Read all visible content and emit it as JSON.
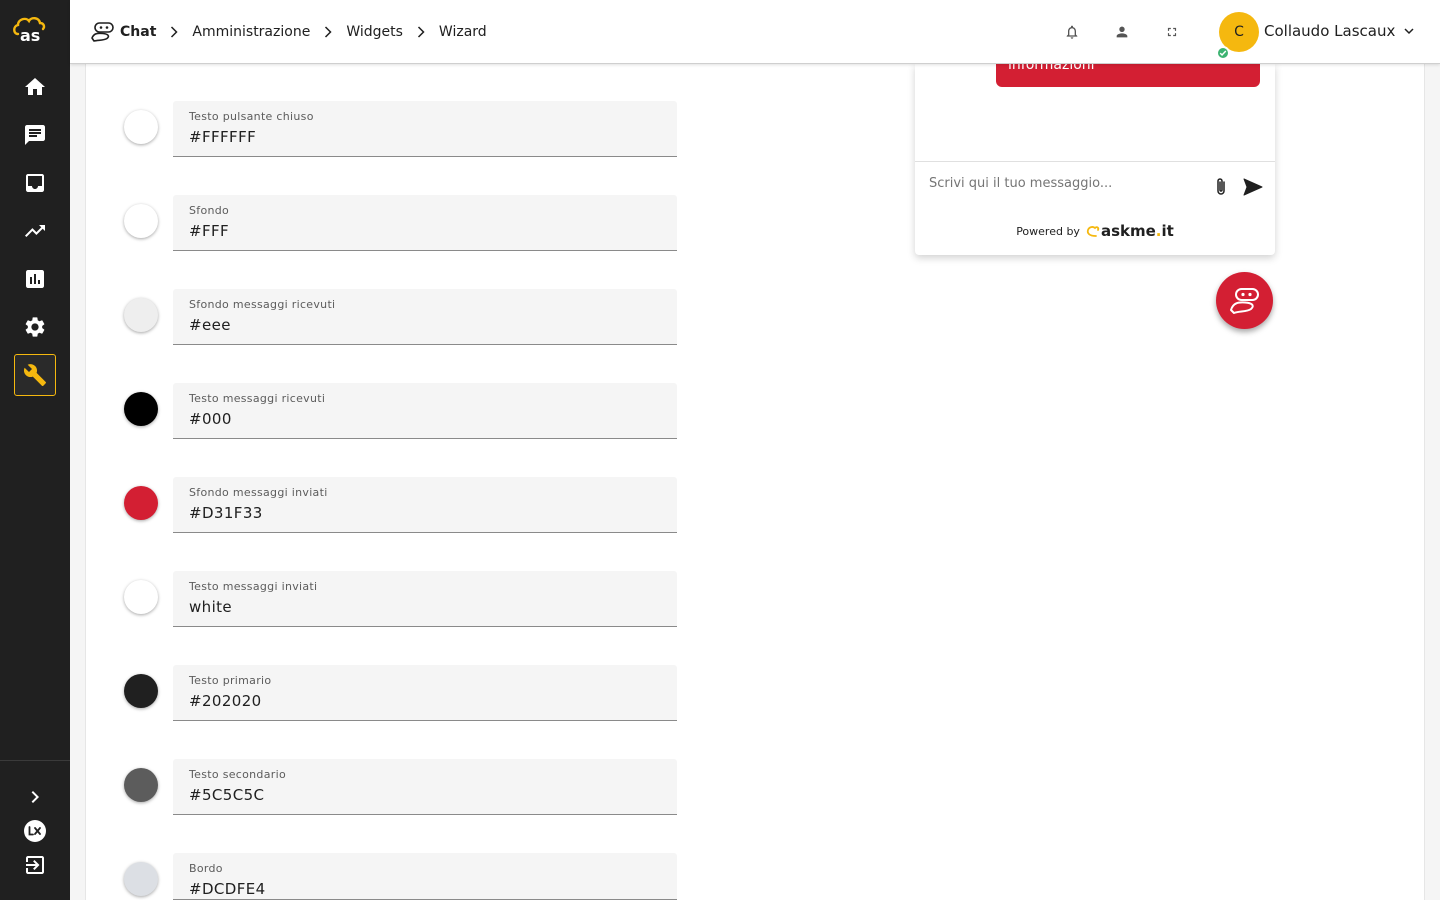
{
  "header": {
    "breadcrumb": [
      "Chat",
      "Amministrazione",
      "Widgets",
      "Wizard"
    ],
    "user": {
      "initial": "C",
      "name": "Collaudo Lascaux"
    }
  },
  "sidebar": {
    "logo_text": "as",
    "items": [
      {
        "icon": "home-icon"
      },
      {
        "icon": "chat-icon"
      },
      {
        "icon": "inbox-icon"
      },
      {
        "icon": "trending-up-icon"
      },
      {
        "icon": "bar-chart-icon"
      },
      {
        "icon": "gear-icon"
      },
      {
        "icon": "wrench-icon",
        "active": true
      }
    ],
    "bottom_items": [
      {
        "icon": "chevron-right-icon"
      },
      {
        "icon": "lx-icon"
      },
      {
        "icon": "logout-icon"
      }
    ]
  },
  "colors": {
    "accent": "#F5B80F",
    "sidebar_bg": "#202020",
    "brand_red": "#D31F33"
  },
  "color_fields": [
    {
      "label": "Testo pulsante chiuso",
      "value": "#FFFFFF",
      "swatch": "#FFFFFF"
    },
    {
      "label": "Sfondo",
      "value": "#FFF",
      "swatch": "#FFFFFF"
    },
    {
      "label": "Sfondo messaggi ricevuti",
      "value": "#eee",
      "swatch": "#EEEEEE"
    },
    {
      "label": "Testo messaggi ricevuti",
      "value": "#000",
      "swatch": "#000000"
    },
    {
      "label": "Sfondo messaggi inviati",
      "value": "#D31F33",
      "swatch": "#D31F33"
    },
    {
      "label": "Testo messaggi inviati",
      "value": "white",
      "swatch": "#FFFFFF"
    },
    {
      "label": "Testo primario",
      "value": "#202020",
      "swatch": "#202020"
    },
    {
      "label": "Testo secondario",
      "value": "#5C5C5C",
      "swatch": "#5C5C5C"
    },
    {
      "label": "Bordo",
      "value": "#DCDFE4",
      "swatch": "#DCDFE4"
    }
  ],
  "widget": {
    "sent_message": "informazioni",
    "input_placeholder": "Scrivi qui il tuo messaggio...",
    "powered_by": "Powered by",
    "brand_name": "askme",
    "brand_dot": ".",
    "brand_tld": "it"
  }
}
